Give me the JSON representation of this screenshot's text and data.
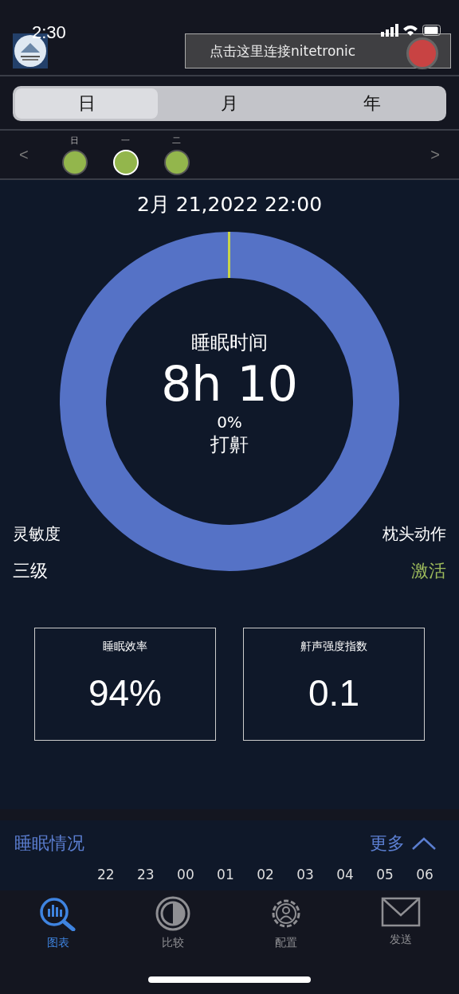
{
  "status_bar": {
    "time": "2:30"
  },
  "connect_banner": {
    "label": "点击这里连接nitetronic"
  },
  "period_tabs": [
    {
      "label": "日",
      "selected": true
    },
    {
      "label": "月",
      "selected": false
    },
    {
      "label": "年",
      "selected": false
    }
  ],
  "days": [
    {
      "label": "日",
      "selected": false
    },
    {
      "label": "一",
      "selected": true
    },
    {
      "label": "二",
      "selected": false
    }
  ],
  "nav": {
    "prev": "<",
    "next": ">"
  },
  "date": "2月 21,2022 22:00",
  "summary": {
    "title": "睡眠时间",
    "duration": "8h 10",
    "snore_percent": "0%",
    "snore_label": "打鼾"
  },
  "sensitivity": {
    "label": "灵敏度",
    "value": "三级"
  },
  "pillow_motion": {
    "label": "枕头动作",
    "value": "激活"
  },
  "metrics": [
    {
      "label": "睡眠效率",
      "value": "94%"
    },
    {
      "label": "鼾声强度指数",
      "value": "0.1"
    }
  ],
  "sleep_section": {
    "title": "睡眠情况",
    "more": "更多",
    "hours": [
      "22",
      "23",
      "00",
      "01",
      "02",
      "03",
      "04",
      "05",
      "06"
    ]
  },
  "bottom_tabs": [
    {
      "label": "图表",
      "kind": "chart",
      "selected": true
    },
    {
      "label": "比较",
      "kind": "compare",
      "selected": false
    },
    {
      "label": "配置",
      "kind": "config",
      "selected": false
    },
    {
      "label": "发送",
      "kind": "send",
      "selected": false
    }
  ]
}
